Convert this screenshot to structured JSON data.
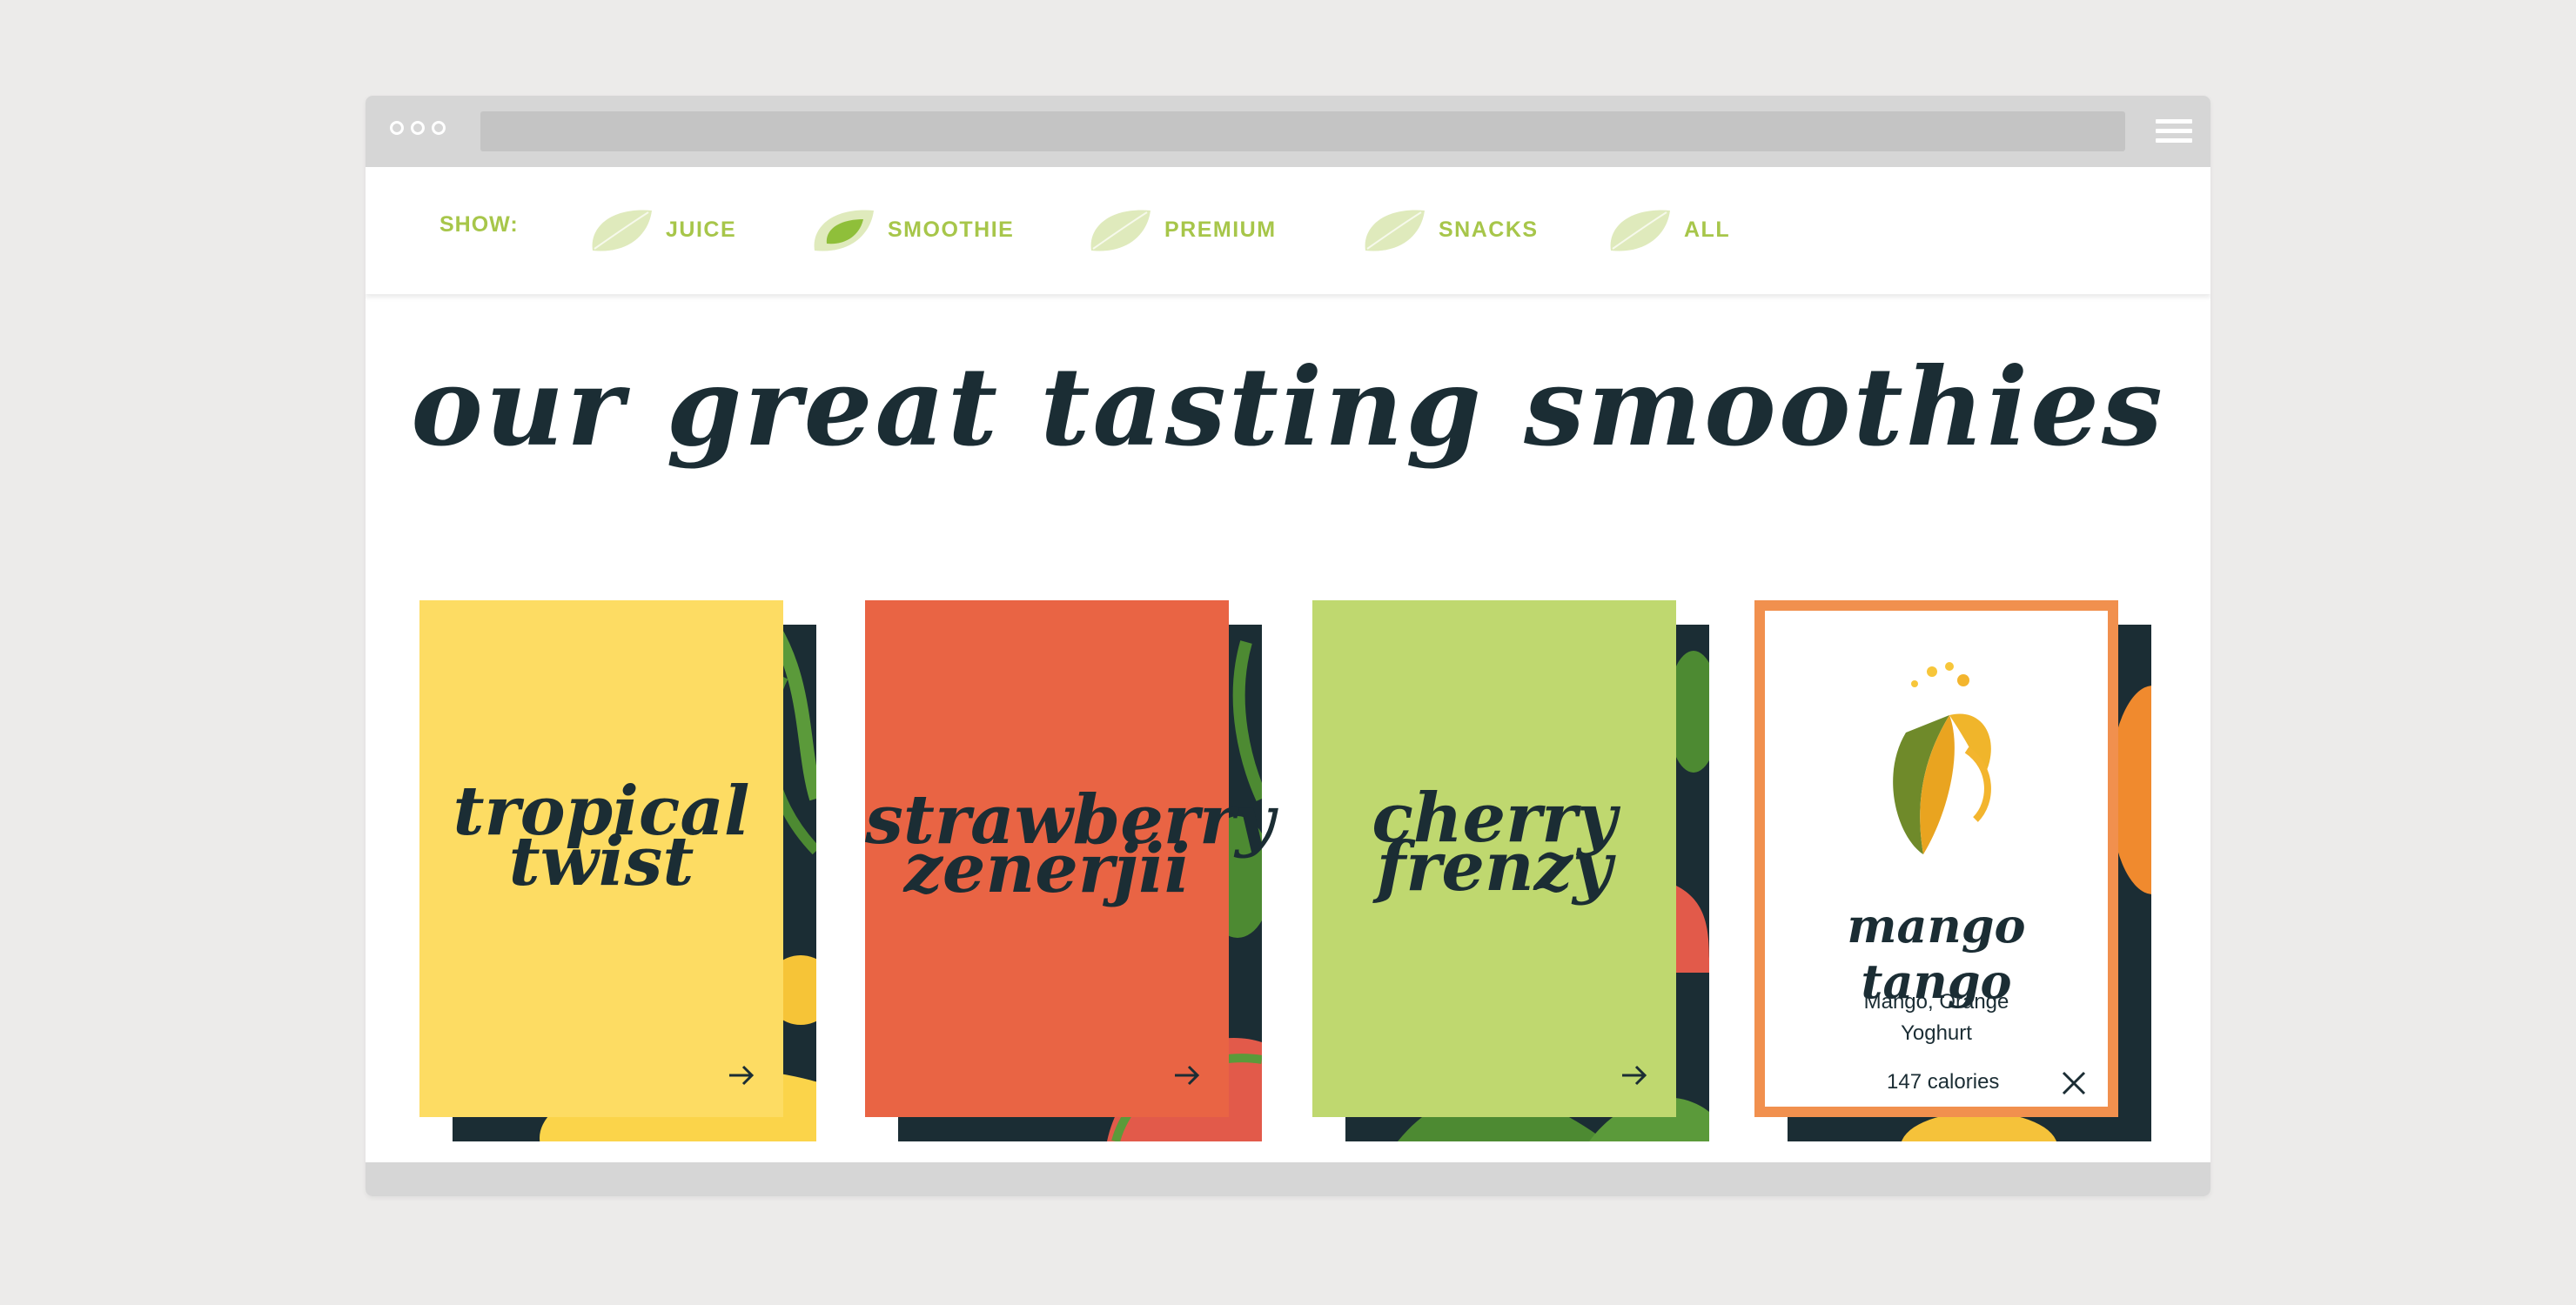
{
  "filters": {
    "show_label": "SHOW:",
    "items": [
      {
        "label": "JUICE",
        "active": false
      },
      {
        "label": "SMOOTHIE",
        "active": true
      },
      {
        "label": "PREMIUM",
        "active": false
      },
      {
        "label": "SNACKS",
        "active": false
      },
      {
        "label": "ALL",
        "active": false
      }
    ]
  },
  "page_title": "our great tasting smoothies",
  "cards": [
    {
      "name_line1": "tropical",
      "name_line2": "twist",
      "color": "#fddc63"
    },
    {
      "name_line1": "strawberry",
      "name_line2": "zenerjii",
      "color": "#e96444"
    },
    {
      "name_line1": "cherry",
      "name_line2": "frenzy",
      "color": "#bfd86f"
    },
    {
      "name": "mango tango",
      "ingredients_line1": "Mango, Orange",
      "ingredients_line2": "Yoghurt",
      "calories": "147 calories",
      "border_color": "#f1904e"
    }
  ],
  "colors": {
    "accent_green": "#a7c64a",
    "dark_navy": "#1b2d34",
    "chrome_gray": "#d6d6d6"
  },
  "icons": {
    "filter": "leaf-icon",
    "card_action": "arrow-right-icon",
    "close": "close-icon",
    "menu": "hamburger-icon"
  }
}
